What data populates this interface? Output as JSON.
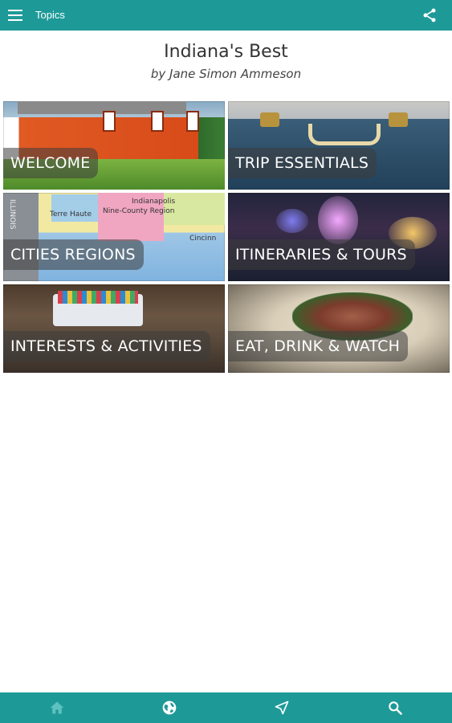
{
  "appbar": {
    "title": "Topics"
  },
  "header": {
    "title": "Indiana's Best",
    "author": "by Jane Simon Ammeson"
  },
  "tiles": [
    {
      "label": "WELCOME"
    },
    {
      "label": "TRIP ESSENTIALS"
    },
    {
      "label": "CITIES REGIONS"
    },
    {
      "label": "ITINERARIES & TOURS"
    },
    {
      "label": "INTERESTS & ACTIVITIES"
    },
    {
      "label": "EAT, DRINK & WATCH"
    }
  ],
  "map_labels": {
    "terre_haute": "Terre Haute",
    "region": "Nine-County Region",
    "indianapolis": "Indianapolis",
    "cincinnati": "Cincinn",
    "illinois": "ILLINOIS"
  },
  "bottom_nav": [
    "home-icon",
    "globe-icon",
    "navigate-icon",
    "search-icon"
  ],
  "colors": {
    "accent": "#1d9a98"
  }
}
